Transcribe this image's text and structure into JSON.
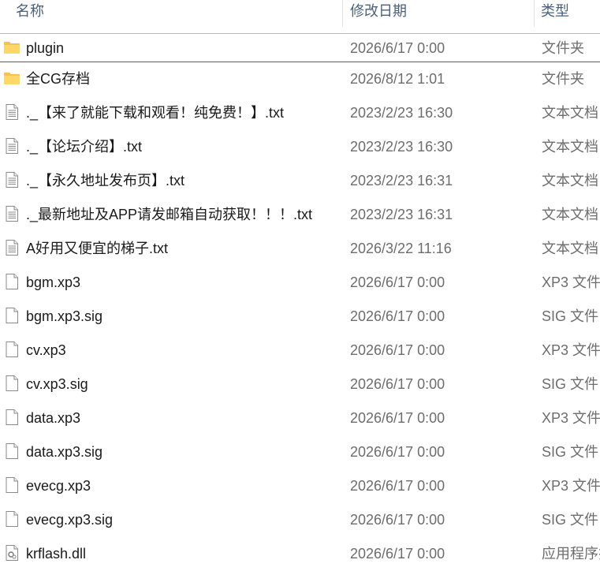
{
  "header": {
    "col_name": "名称",
    "col_date": "修改日期",
    "col_type": "类型"
  },
  "files": [
    {
      "name": "plugin",
      "date": "2026/6/17 0:00",
      "type": "文件夹",
      "icon": "folder-icon"
    },
    {
      "name": "全CG存档",
      "date": "2026/8/12 1:01",
      "type": "文件夹",
      "icon": "folder-icon"
    },
    {
      "name": "._【来了就能下载和观看！纯免费！】.txt",
      "date": "2023/2/23 16:30",
      "type": "文本文档",
      "icon": "text-file-icon"
    },
    {
      "name": "._【论坛介绍】.txt",
      "date": "2023/2/23 16:30",
      "type": "文本文档",
      "icon": "text-file-icon"
    },
    {
      "name": "._【永久地址发布页】.txt",
      "date": "2023/2/23 16:31",
      "type": "文本文档",
      "icon": "text-file-icon"
    },
    {
      "name": "._最新地址及APP请发邮箱自动获取！！！.txt",
      "date": "2023/2/23 16:31",
      "type": "文本文档",
      "icon": "text-file-icon"
    },
    {
      "name": "A好用又便宜的梯子.txt",
      "date": "2026/3/22 11:16",
      "type": "文本文档",
      "icon": "text-file-icon"
    },
    {
      "name": "bgm.xp3",
      "date": "2026/6/17 0:00",
      "type": "XP3 文件",
      "icon": "file-icon"
    },
    {
      "name": "bgm.xp3.sig",
      "date": "2026/6/17 0:00",
      "type": "SIG 文件",
      "icon": "file-icon"
    },
    {
      "name": "cv.xp3",
      "date": "2026/6/17 0:00",
      "type": "XP3 文件",
      "icon": "file-icon"
    },
    {
      "name": "cv.xp3.sig",
      "date": "2026/6/17 0:00",
      "type": "SIG 文件",
      "icon": "file-icon"
    },
    {
      "name": "data.xp3",
      "date": "2026/6/17 0:00",
      "type": "XP3 文件",
      "icon": "file-icon"
    },
    {
      "name": "data.xp3.sig",
      "date": "2026/6/17 0:00",
      "type": "SIG 文件",
      "icon": "file-icon"
    },
    {
      "name": "evecg.xp3",
      "date": "2026/6/17 0:00",
      "type": "XP3 文件",
      "icon": "file-icon"
    },
    {
      "name": "evecg.xp3.sig",
      "date": "2026/6/17 0:00",
      "type": "SIG 文件",
      "icon": "file-icon"
    },
    {
      "name": "krflash.dll",
      "date": "2026/6/17 0:00",
      "type": "应用程序扩",
      "icon": "dll-file-icon"
    }
  ]
}
